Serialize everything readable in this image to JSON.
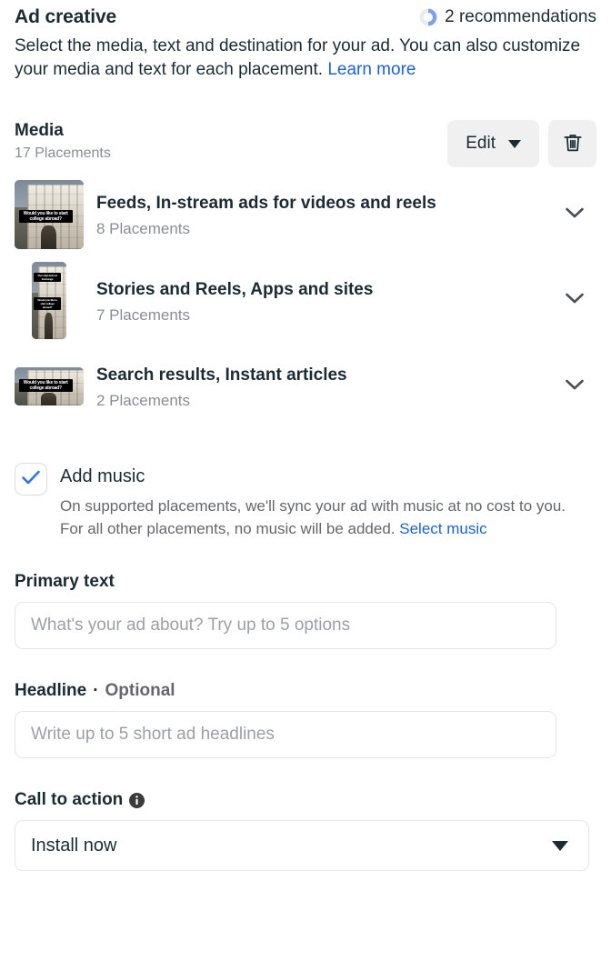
{
  "header": {
    "title": "Ad creative",
    "recommendations": "2 recommendations",
    "recommendations_icon": "progress-ring-icon",
    "description_part1": "Select the media, text and destination for your ad. You can also customize your media and text for each placement. ",
    "learn_more": "Learn more"
  },
  "media": {
    "title": "Media",
    "subtitle": "17 Placements",
    "edit_label": "Edit",
    "edit_caret_icon": "caret-down-icon",
    "delete_icon": "trash-icon",
    "thumb_caption_main": "Would you like to start college abroad?",
    "thumb_caption_top": "Vivo High School Exchange",
    "rows": [
      {
        "name": "Feeds, In-stream ads for videos and reels",
        "count": "8 Placements",
        "chevron_icon": "chevron-down-icon",
        "shape": "square"
      },
      {
        "name": "Stories and Reels, Apps and sites",
        "count": "7 Placements",
        "chevron_icon": "chevron-down-icon",
        "shape": "portrait"
      },
      {
        "name": "Search results, Instant articles",
        "count": "2 Placements",
        "chevron_icon": "chevron-down-icon",
        "shape": "land"
      }
    ]
  },
  "add_music": {
    "checked": true,
    "check_icon": "checkmark-icon",
    "label": "Add music",
    "description": "On supported placements, we'll sync your ad with music at no cost to you. For all other placements, no music will be added. ",
    "select_music_link": "Select music"
  },
  "primary_text": {
    "label": "Primary text",
    "placeholder": "What's your ad about? Try up to 5 options",
    "value": ""
  },
  "headline": {
    "label": "Headline",
    "separator": " · ",
    "optional": "Optional",
    "placeholder": "Write up to 5 short ad headlines",
    "value": ""
  },
  "call_to_action": {
    "label": "Call to action",
    "info_icon": "info-icon",
    "selected": "Install now",
    "caret_icon": "caret-down-icon"
  },
  "colors": {
    "accent_blue": "#1b62d6",
    "ring_blue": "#7f9ff0",
    "ring_track": "#e9ebee",
    "button_bg": "#f0f0f0",
    "muted_text": "#8a8d91",
    "border": "#e4e6eb"
  }
}
